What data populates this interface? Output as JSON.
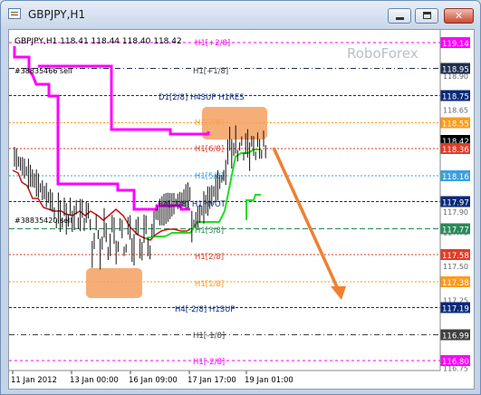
{
  "window": {
    "title": "GBPJPY,H1",
    "minimize_icon": "minimize-icon",
    "maximize_icon": "maximize-icon",
    "close_icon": "close-icon"
  },
  "chart": {
    "symbol_info": "GBPJPY,H1   118.41 118.44 118.40 118.42",
    "order_label": "#38835466 sell",
    "order_label2": "#38835420 sell",
    "watermark": "RoboForex",
    "x_ticks": [
      "11 Jan 2012",
      "13 Jan 00:00",
      "16 Jan 09:00",
      "17 Jan 17:00",
      "19 Jan 01:00"
    ],
    "y_ticks": [
      "119.15",
      "118.90",
      "118.65",
      "118.40",
      "118.15",
      "117.90",
      "117.75",
      "117.50",
      "117.25",
      "117.00",
      "116.75"
    ],
    "price_boxes": [
      {
        "value": "119.14",
        "bg": "#ff00ff",
        "fg": "#ffffff"
      },
      {
        "value": "118.95",
        "bg": "#1f2f4f",
        "fg": "#ffffff"
      },
      {
        "value": "118.75",
        "bg": "#0a2a7a",
        "fg": "#ffffff"
      },
      {
        "value": "118.55",
        "bg": "#ff9a1a",
        "fg": "#ffffff"
      },
      {
        "value": "118.42",
        "bg": "#000000",
        "fg": "#ffffff"
      },
      {
        "value": "118.36",
        "bg": "#e03c28",
        "fg": "#ffffff"
      },
      {
        "value": "118.16",
        "bg": "#3aa0e0",
        "fg": "#ffffff"
      },
      {
        "value": "117.97",
        "bg": "#0a2a7a",
        "fg": "#ffffff"
      },
      {
        "value": "117.77",
        "bg": "#2a8a5a",
        "fg": "#ffffff"
      },
      {
        "value": "117.58",
        "bg": "#e03c28",
        "fg": "#ffffff"
      },
      {
        "value": "117.38",
        "bg": "#ff9a1a",
        "fg": "#ffffff"
      },
      {
        "value": "117.19",
        "bg": "#0a2a7a",
        "fg": "#ffffff"
      },
      {
        "value": "116.99",
        "bg": "#3f3f3f",
        "fg": "#ffffff"
      },
      {
        "value": "116.80",
        "bg": "#ff00ff",
        "fg": "#ffffff"
      }
    ],
    "level_labels": [
      {
        "text": "H1[+2/8]",
        "color": "#ff00ff"
      },
      {
        "text": "H1[+1/8]",
        "color": "#3f3f3f"
      },
      {
        "text": "D1[2/8] H4SUP H1RES",
        "color": "#0a2a7a"
      },
      {
        "text": "H1[7/8]",
        "color": "#ff9a1a"
      },
      {
        "text": "H1[6/8]",
        "color": "#e03c28"
      },
      {
        "text": "H1[5/8]",
        "color": "#3aa0e0"
      },
      {
        "text": "H4[-1/8] H1PIVOT",
        "color": "#0a2a7a"
      },
      {
        "text": "H1[3/8]",
        "color": "#2a8a5a"
      },
      {
        "text": "H1[2/8]",
        "color": "#e03c28"
      },
      {
        "text": "H1[1/8]",
        "color": "#ff9a1a"
      },
      {
        "text": "H4[-2/8] H1SUP",
        "color": "#0a2a7a"
      },
      {
        "text": "H1[-1/8]",
        "color": "#3f3f3f"
      },
      {
        "text": "H1[-2/8]",
        "color": "#ff00ff"
      }
    ],
    "colors": {
      "magenta": "#ff00ff",
      "red": "#cc1010",
      "green": "#22dd22",
      "arrow": "#f08030",
      "highlight": "#f4a060",
      "bars": "#111111"
    }
  }
}
